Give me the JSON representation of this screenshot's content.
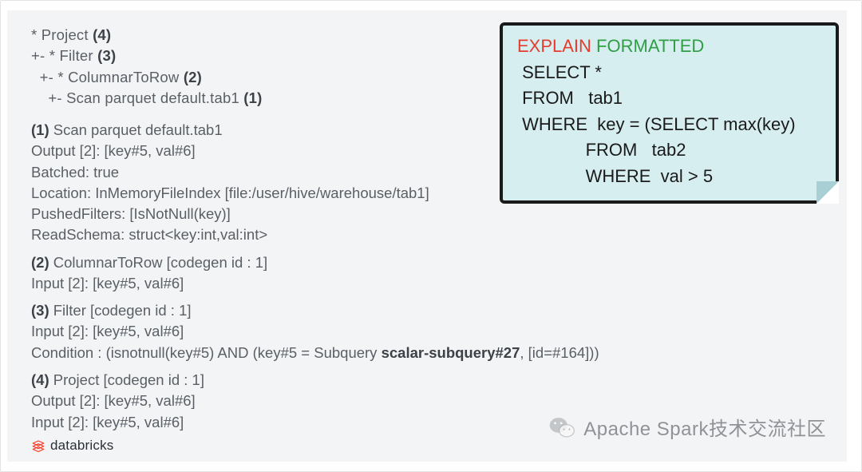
{
  "plan_tree": {
    "l1_prefix": "* Project ",
    "l1_bold": "(4)",
    "l2_prefix": "+- * Filter ",
    "l2_bold": "(3)",
    "l3_prefix": "  +- * ColumnarToRow ",
    "l3_bold": "(2)",
    "l4_prefix": "    +- Scan parquet default.tab1 ",
    "l4_bold": "(1)"
  },
  "blocks": {
    "b1": {
      "num": "(1) ",
      "title": "Scan parquet default.tab1",
      "lines": [
        "Output [2]: [key#5, val#6]",
        "Batched: true",
        "Location: InMemoryFileIndex [file:/user/hive/warehouse/tab1]",
        "PushedFilters: [IsNotNull(key)]",
        "ReadSchema: struct<key:int,val:int>"
      ]
    },
    "b2": {
      "num": "(2) ",
      "title": "ColumnarToRow [codegen id : 1]",
      "lines": [
        "Input [2]: [key#5, val#6]"
      ]
    },
    "b3": {
      "num": "(3) ",
      "title": "Filter [codegen id : 1]",
      "input_line": "Input [2]: [key#5, val#6]",
      "cond_prefix": "Condition : (isnotnull(key#5) AND (key#5 = Subquery ",
      "cond_bold": "scalar-subquery#27",
      "cond_suffix": ", [id=#164]))"
    },
    "b4": {
      "num": "(4) ",
      "title": "Project [codegen id : 1]",
      "lines": [
        "Output [2]: [key#5, val#6]",
        "Input [2]: [key#5, val#6]"
      ]
    }
  },
  "sql": {
    "explain": "EXPLAIN",
    "formatted": " FORMATTED",
    "l2": " SELECT *",
    "l3": " FROM   tab1",
    "l4": " WHERE  key = (SELECT max(key)",
    "l5": "              FROM   tab2",
    "l6": "              WHERE  val > 5"
  },
  "logo_text": "databricks",
  "watermark_text": "Apache Spark技术交流社区"
}
